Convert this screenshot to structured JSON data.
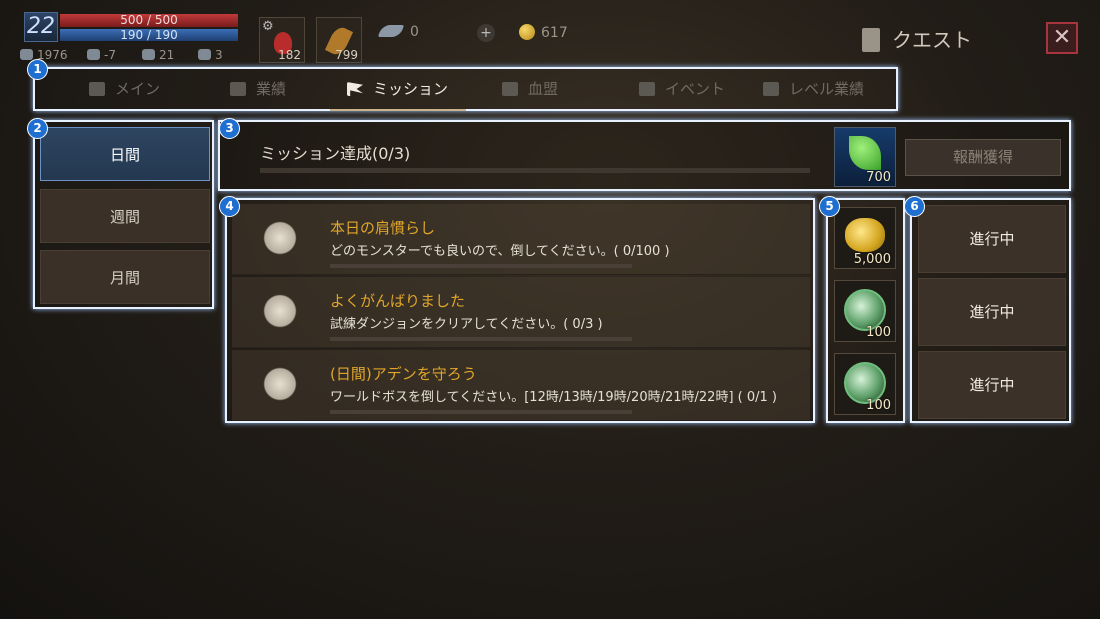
{
  "player": {
    "level": "22",
    "hp": "500 / 500",
    "mp": "190 / 190",
    "stats": [
      "1976",
      "-7",
      "21",
      "3"
    ]
  },
  "quick_slots": [
    {
      "icon": "potion-icon",
      "count": "182"
    },
    {
      "icon": "feather-icon",
      "count": "799"
    }
  ],
  "currency": {
    "wing_count": "0",
    "gold": "617"
  },
  "header": {
    "title": "クエスト",
    "close_label": "✕"
  },
  "badges": [
    "1",
    "2",
    "3",
    "4",
    "5",
    "6"
  ],
  "tabs": [
    {
      "label": "メイン",
      "active": false
    },
    {
      "label": "業績",
      "active": false
    },
    {
      "label": "ミッション",
      "active": true
    },
    {
      "label": "血盟",
      "active": false
    },
    {
      "label": "イベント",
      "active": false
    },
    {
      "label": "レベル業績",
      "active": false
    }
  ],
  "periods": [
    {
      "label": "日間",
      "active": true
    },
    {
      "label": "週間",
      "active": false
    },
    {
      "label": "月間",
      "active": false
    }
  ],
  "summary": {
    "label": "ミッション達成(0/3)",
    "progress": 0,
    "reward_count": "700",
    "claim_label": "報酬獲得"
  },
  "missions": [
    {
      "title": "本日の肩慣らし",
      "description": "どのモンスターでも良いので、倒してください。( 0/100 )",
      "progress": 0,
      "reward_icon": "gold-coins-icon",
      "reward_count": "5,000",
      "status": "進行中"
    },
    {
      "title": "よくがんばりました",
      "description": "試練ダンジョンをクリアしてください。( 0/3 )",
      "progress": 0,
      "reward_icon": "green-orb-icon",
      "reward_count": "100",
      "status": "進行中"
    },
    {
      "title": "(日間)アデンを守ろう",
      "description": "ワールドボスを倒してください。[12時/13時/19時/20時/21時/22時] ( 0/1 )",
      "progress": 0,
      "reward_icon": "green-orb-icon",
      "reward_count": "100",
      "status": "進行中"
    }
  ]
}
